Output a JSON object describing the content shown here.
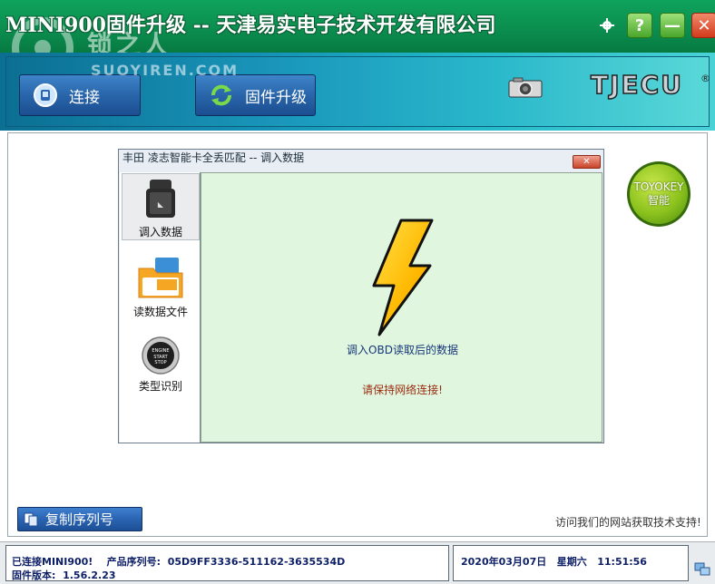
{
  "window": {
    "title": "MINI900固件升级 -- 天津易实电子技术开发有限公司"
  },
  "watermark": {
    "text": "锁之人",
    "sub": "SUOYIREN.COM"
  },
  "window_controls": {
    "settings_icon": "gear-icon",
    "help_label": "?",
    "minimize_label": "—",
    "close_label": "✕"
  },
  "toolbar": {
    "connect_label": "连接",
    "upgrade_label": "固件升级",
    "brand": "TJECU",
    "brand_reg": "®"
  },
  "dialog": {
    "title": "丰田 凌志智能卡全丢匹配 -- 调入数据",
    "close_label": "✕",
    "sidebar": [
      {
        "label": "调入数据",
        "icon": "obd-connector-icon",
        "active": true
      },
      {
        "label": "读数据文件",
        "icon": "folder-icon",
        "active": false
      },
      {
        "label": "类型识别",
        "icon": "start-stop-button-icon",
        "active": false
      }
    ],
    "content": {
      "main_text": "调入OBD读取后的数据",
      "warning_text": "请保持网络连接!"
    }
  },
  "toyokey": {
    "label_line1": "TOYOKEY",
    "label_line2": "智能"
  },
  "footer": {
    "copy_serial_label": "复制序列号",
    "support_text": "访问我们的网站获取技术支持!"
  },
  "status": {
    "connected": "已连接MINI900!",
    "serial_label": "产品序列号:",
    "serial_value": "05D9FF3336-511162-3635534D",
    "firmware_label": "固件版本:",
    "firmware_value": "1.56.2.23",
    "date": "2020年03月07日",
    "weekday": "星期六",
    "time": "11:51:56"
  },
  "colors": {
    "titlebar": "#0b8e4f",
    "toolbar": "#148fb5",
    "content_bg": "#e0f6de",
    "status_text": "#0d1f66"
  }
}
